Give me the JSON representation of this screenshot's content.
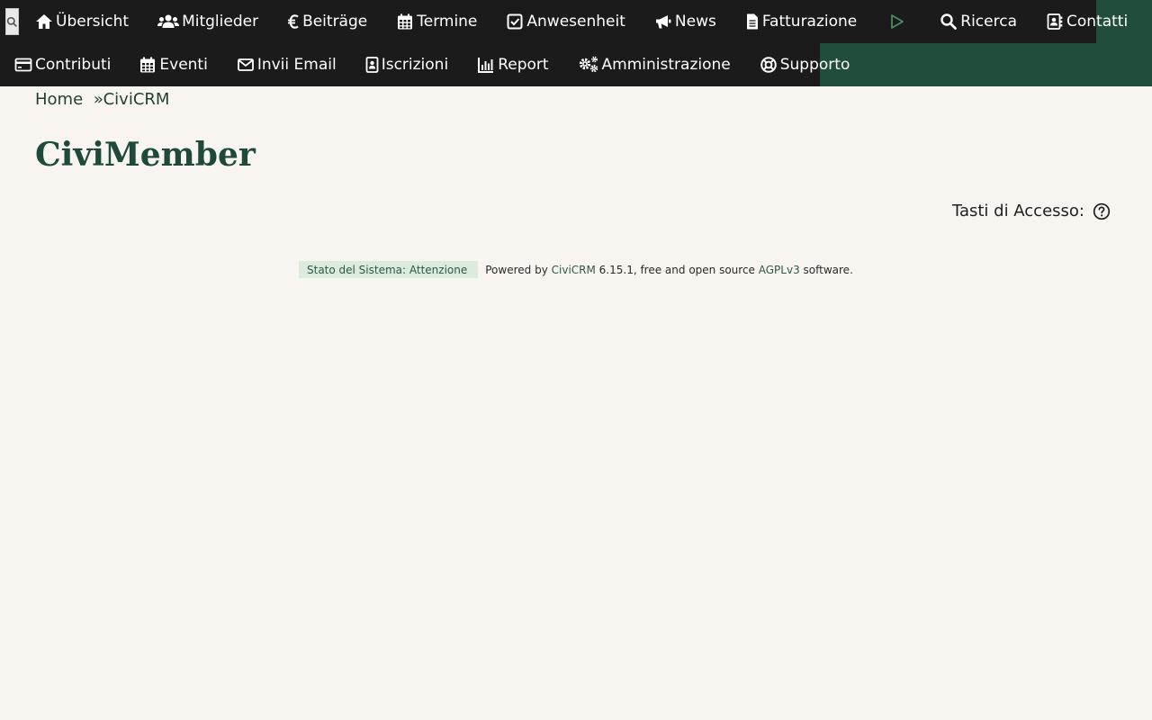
{
  "menu": {
    "row1": [
      {
        "id": "uebersicht",
        "label": "Übersicht",
        "icon": "home-icon"
      },
      {
        "id": "mitglieder",
        "label": "Mitglieder",
        "icon": "users-icon"
      },
      {
        "id": "beitraege",
        "label": "Beiträge",
        "icon": "euro-icon"
      },
      {
        "id": "termine",
        "label": "Termine",
        "icon": "calendar-icon"
      },
      {
        "id": "anwesenheit",
        "label": "Anwesenheit",
        "icon": "check-square-icon"
      },
      {
        "id": "news",
        "label": "News",
        "icon": "megaphone-icon"
      },
      {
        "id": "fatturazione",
        "label": "Fatturazione",
        "icon": "document-icon"
      },
      {
        "id": "play",
        "label": "",
        "icon": "play-icon"
      },
      {
        "id": "ricerca",
        "label": "Ricerca",
        "icon": "search-icon"
      },
      {
        "id": "contatti",
        "label": "Contatti",
        "icon": "address-book-icon"
      }
    ],
    "row2": [
      {
        "id": "contributi",
        "label": "Contributi",
        "icon": "credit-card-icon"
      },
      {
        "id": "eventi",
        "label": "Eventi",
        "icon": "calendar-icon"
      },
      {
        "id": "invii-email",
        "label": "Invii Email",
        "icon": "envelope-icon"
      },
      {
        "id": "iscrizioni",
        "label": "Iscrizioni",
        "icon": "id-badge-icon"
      },
      {
        "id": "report",
        "label": "Report",
        "icon": "bar-chart-icon"
      },
      {
        "id": "amministrazione",
        "label": "Amministrazione",
        "icon": "cogs-icon"
      },
      {
        "id": "supporto",
        "label": "Supporto",
        "icon": "life-ring-icon"
      }
    ]
  },
  "breadcrumb": {
    "home": "Home",
    "separator": "»",
    "current": "CiviCRM"
  },
  "page": {
    "title": "CiviMember"
  },
  "access_keys": {
    "label": "Tasti di Accesso:",
    "icon": "question-circle-icon"
  },
  "footer": {
    "status": "Stato del Sistema: Attenzione",
    "powered_prefix": "Powered by ",
    "civicrm_link": "CiviCRM",
    "version_text": " 6.15.1, free and open source ",
    "license_link": "AGPLv3",
    "suffix": " software."
  },
  "colors": {
    "menubar": "#1b1b1b",
    "menubar_accent": "#214e3a",
    "background": "#f8f5f0",
    "title": "#1f4a3a",
    "status_badge_bg": "#dcebdc"
  }
}
